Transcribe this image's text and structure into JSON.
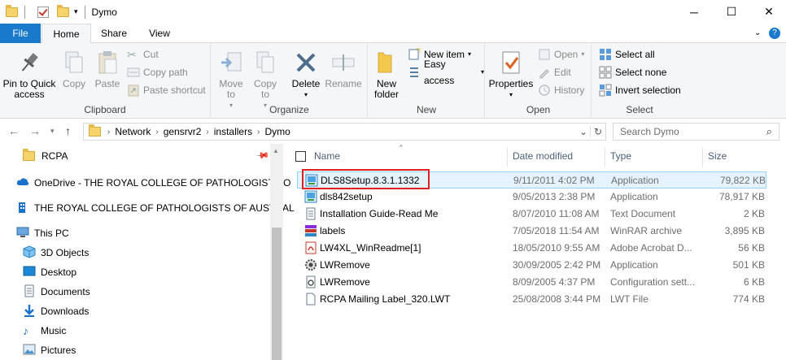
{
  "window": {
    "title": "Dymo"
  },
  "tabs": {
    "file": "File",
    "home": "Home",
    "share": "Share",
    "view": "View"
  },
  "ribbon": {
    "clipboard": {
      "label": "Clipboard",
      "pin": "Pin to Quick access",
      "copy": "Copy",
      "paste": "Paste",
      "cut": "Cut",
      "copy_path": "Copy path",
      "paste_shortcut": "Paste shortcut"
    },
    "organize": {
      "label": "Organize",
      "move_to": "Move to",
      "copy_to": "Copy to",
      "delete": "Delete",
      "rename": "Rename"
    },
    "new": {
      "label": "New",
      "new_folder": "New folder",
      "new_item": "New item",
      "easy_access": "Easy access"
    },
    "open": {
      "label": "Open",
      "properties": "Properties",
      "open": "Open",
      "edit": "Edit",
      "history": "History"
    },
    "select": {
      "label": "Select",
      "select_all": "Select all",
      "select_none": "Select none",
      "invert": "Invert selection"
    }
  },
  "address": {
    "crumbs": [
      "Network",
      "gensrvr2",
      "installers",
      "Dymo"
    ],
    "search_placeholder": "Search Dymo"
  },
  "nav": {
    "items": [
      "RCPA",
      "OneDrive - THE ROYAL COLLEGE OF PATHOLOGISTS O",
      "THE ROYAL COLLEGE OF PATHOLOGISTS OF AUSTRAL",
      "This PC",
      "3D Objects",
      "Desktop",
      "Documents",
      "Downloads",
      "Music",
      "Pictures"
    ]
  },
  "columns": {
    "name": "Name",
    "date": "Date modified",
    "type": "Type",
    "size": "Size"
  },
  "files": [
    {
      "name": "DLS8Setup.8.3.1.1332",
      "date": "9/11/2011 4:02 PM",
      "type": "Application",
      "size": "79,822 KB",
      "icon": "installer-icon"
    },
    {
      "name": "dls842setup",
      "date": "9/05/2013 2:38 PM",
      "type": "Application",
      "size": "78,917 KB",
      "icon": "installer-icon"
    },
    {
      "name": "Installation Guide-Read Me",
      "date": "8/07/2010 11:08 AM",
      "type": "Text Document",
      "size": "2 KB",
      "icon": "text-file-icon"
    },
    {
      "name": "labels",
      "date": "7/05/2018 11:54 AM",
      "type": "WinRAR archive",
      "size": "3,895 KB",
      "icon": "winrar-icon"
    },
    {
      "name": "LW4XL_WinReadme[1]",
      "date": "18/05/2010 9:55 AM",
      "type": "Adobe Acrobat D...",
      "size": "56 KB",
      "icon": "pdf-icon"
    },
    {
      "name": "LWRemove",
      "date": "30/09/2005 2:42 PM",
      "type": "Application",
      "size": "501 KB",
      "icon": "app-gear-icon"
    },
    {
      "name": "LWRemove",
      "date": "8/09/2005 4:37 PM",
      "type": "Configuration sett...",
      "size": "6 KB",
      "icon": "config-icon"
    },
    {
      "name": "RCPA Mailing Label_320.LWT",
      "date": "25/08/2008 3:44 PM",
      "type": "LWT File",
      "size": "774 KB",
      "icon": "blank-file-icon"
    }
  ],
  "colors": {
    "accent": "#1979ca",
    "selection_bg": "#e5f3ff",
    "highlight": "#e02020"
  }
}
